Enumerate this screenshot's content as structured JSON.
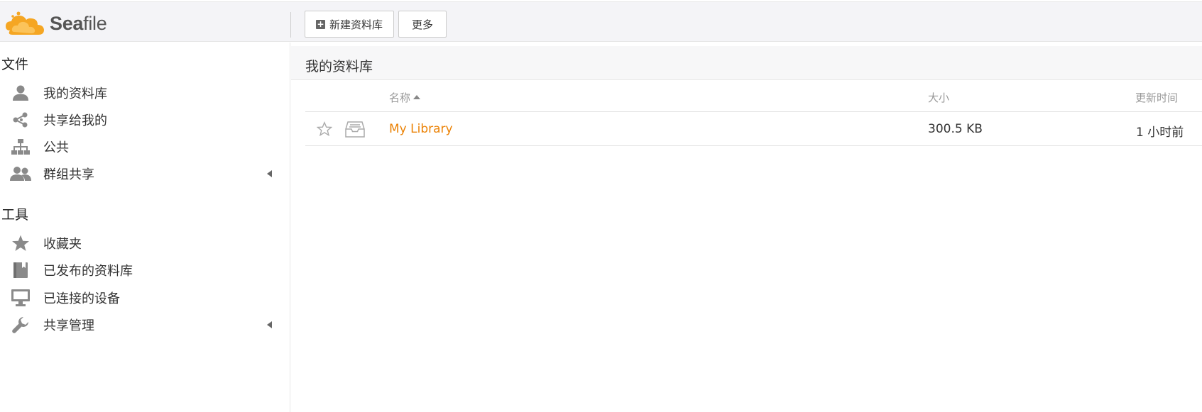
{
  "brand": {
    "prefix": "Sea",
    "suffix": "file"
  },
  "toolbar": {
    "new_library_label": "新建资料库",
    "more_label": "更多"
  },
  "sidebar": {
    "files_title": "文件",
    "file_items": [
      {
        "label": "我的资料库",
        "icon": "user-icon"
      },
      {
        "label": "共享给我的",
        "icon": "share-icon"
      },
      {
        "label": "公共",
        "icon": "sitemap-icon"
      },
      {
        "label": "群组共享",
        "icon": "group-icon"
      }
    ],
    "tools_title": "工具",
    "tool_items": [
      {
        "label": "收藏夹",
        "icon": "star-icon"
      },
      {
        "label": "已发布的资料库",
        "icon": "book-icon"
      },
      {
        "label": "已连接的设备",
        "icon": "monitor-icon"
      },
      {
        "label": "共享管理",
        "icon": "wrench-icon"
      }
    ]
  },
  "main": {
    "title": "我的资料库",
    "columns": {
      "name": "名称",
      "size": "大小",
      "updated": "更新时间"
    },
    "rows": [
      {
        "name": "My Library",
        "size": "300.5 KB",
        "updated": "1 小时前"
      }
    ]
  },
  "colors": {
    "accent": "#eb8205",
    "logo_orange": "#f5a623",
    "icon_gray": "#8a8a8a"
  }
}
